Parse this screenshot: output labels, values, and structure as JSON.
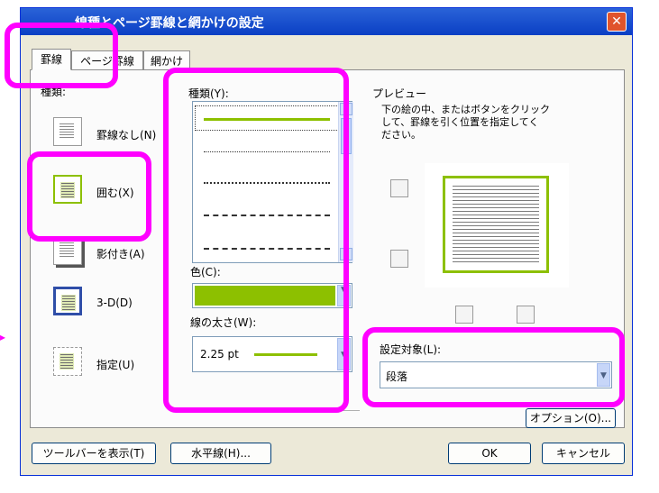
{
  "dialog": {
    "title": "線種とページ罫線と網かけの設定",
    "close_glyph": "✕"
  },
  "tabs": [
    "罫線",
    "ページ罫線",
    "網かけ"
  ],
  "settings": {
    "label": "種類:",
    "items": [
      "罫線なし(N)",
      "囲む(X)",
      "影付き(A)",
      "3-D(D)",
      "指定(U)"
    ]
  },
  "style": {
    "label": "種類(Y):"
  },
  "color": {
    "label": "色(C):",
    "value_color": "#8dc000"
  },
  "width": {
    "label": "線の太さ(W):",
    "value": "2.25 pt"
  },
  "preview": {
    "label": "プレビュー",
    "instructions": [
      "下の絵の中、またはボタンをクリック",
      "して、罫線を引く位置を指定してく",
      "ださい。"
    ]
  },
  "apply_to": {
    "label": "設定対象(L):",
    "value": "段落"
  },
  "buttons": {
    "options": "オプション(O)...",
    "toolbar": "ツールバーを表示(T)",
    "horizontal_line": "水平線(H)...",
    "ok": "OK",
    "cancel": "キャンセル"
  },
  "accent": {
    "highlight": "#ff00ff",
    "line_green": "#8dc000"
  }
}
